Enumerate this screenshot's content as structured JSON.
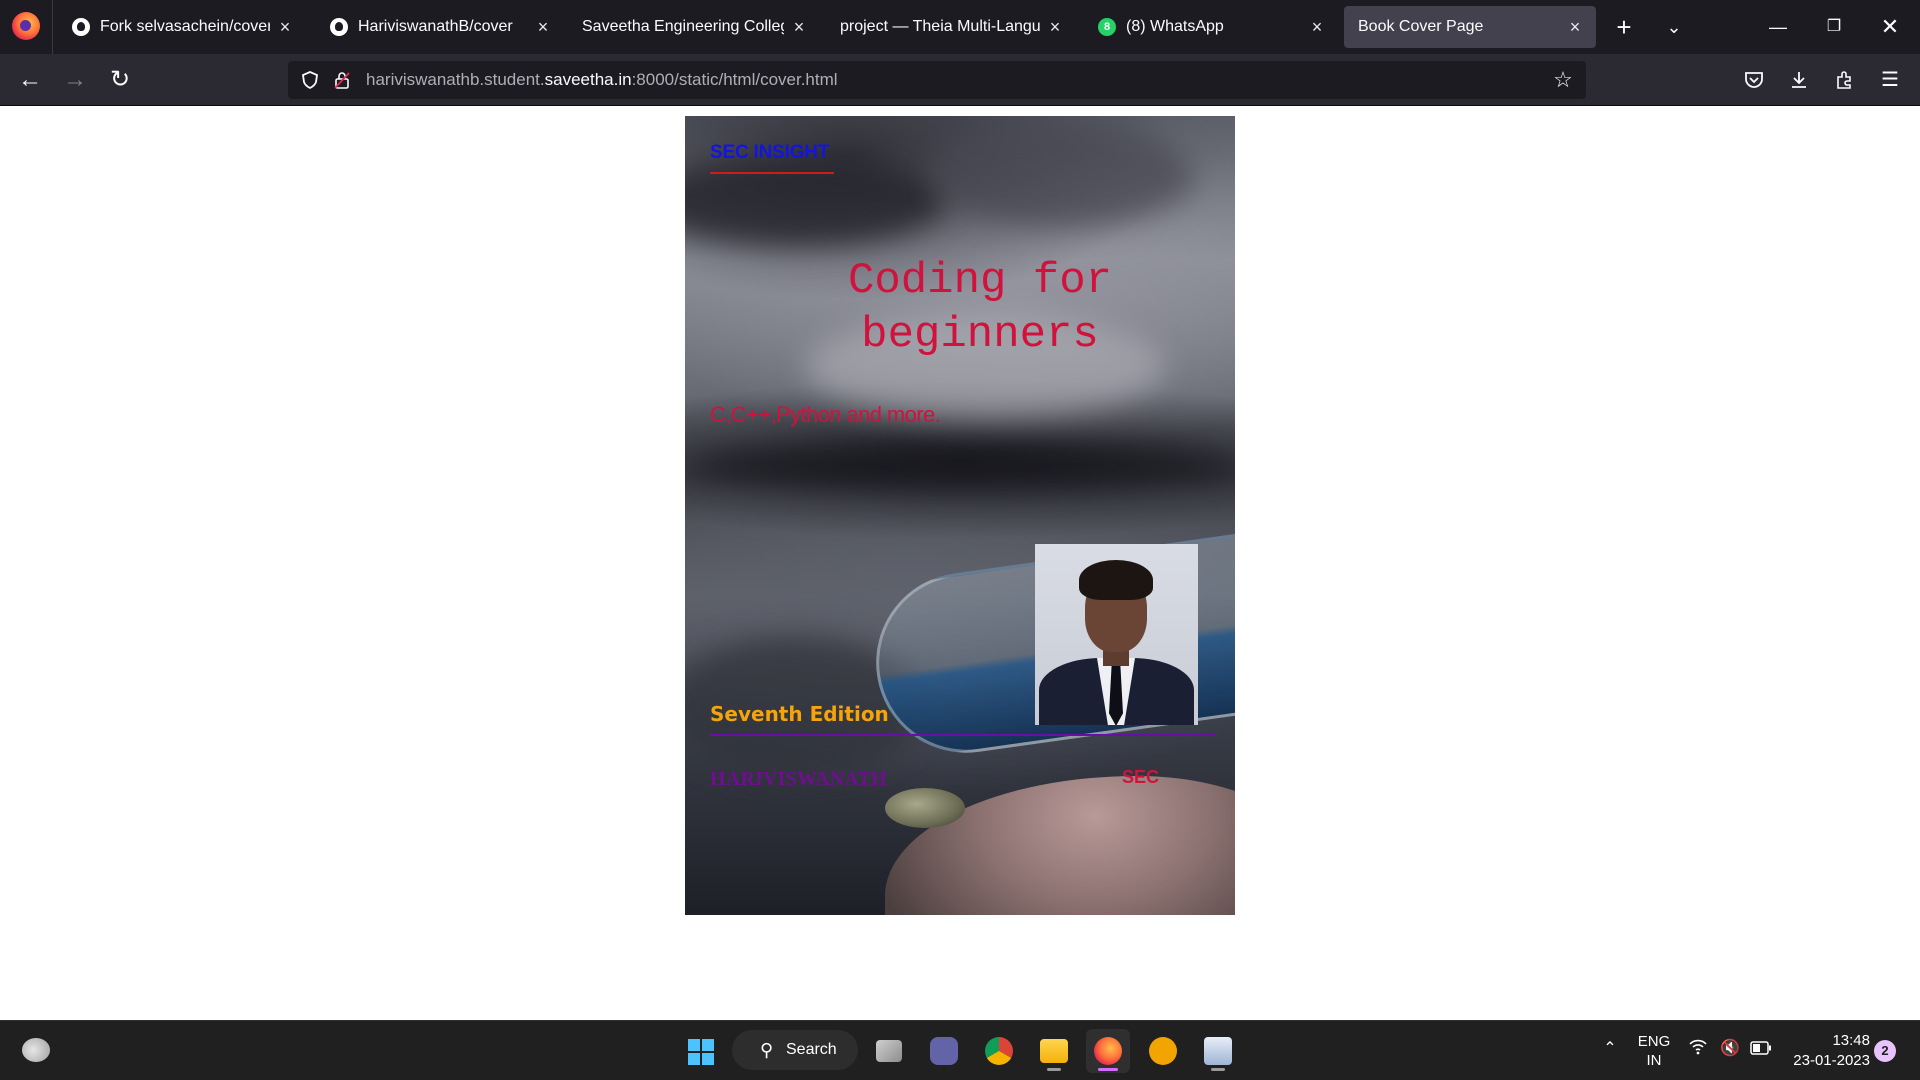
{
  "browser": {
    "tabs": [
      {
        "label": "Fork selvasachein/cover",
        "icon": "github-icon",
        "active": false
      },
      {
        "label": "HariviswanathB/cover",
        "icon": "github-icon",
        "active": false
      },
      {
        "label": "Saveetha Engineering College",
        "icon": "",
        "active": false
      },
      {
        "label": "project — Theia Multi-Language",
        "icon": "",
        "active": false
      },
      {
        "label": "(8) WhatsApp",
        "icon": "whatsapp-icon",
        "badge": "8",
        "active": false
      },
      {
        "label": "Book Cover Page",
        "icon": "",
        "active": true
      }
    ],
    "tab_close_glyph": "×",
    "url": {
      "prefix": "hariviswanathb.student.",
      "domain": "saveetha.in",
      "suffix": ":8000/static/html/cover.html"
    }
  },
  "cover": {
    "brand": "SEC INSIGHT",
    "title_line1": "Coding for",
    "title_line2": "beginners",
    "subtitle": "C,C++,Python and more.",
    "edition": "Seventh Edition",
    "author": "HARIVISWANATH",
    "publisher": "SEC",
    "colors": {
      "brand": "#1414e0",
      "title": "#d0123c",
      "edition": "#f5a40c",
      "author": "#6e0f8f",
      "divider_top": "#d11a1a",
      "divider_bottom": "#6a0ea8"
    }
  },
  "taskbar": {
    "search_label": "Search",
    "lang_line1": "ENG",
    "lang_line2": "IN",
    "time": "13:48",
    "date": "23-01-2023",
    "notification_count": "2"
  }
}
